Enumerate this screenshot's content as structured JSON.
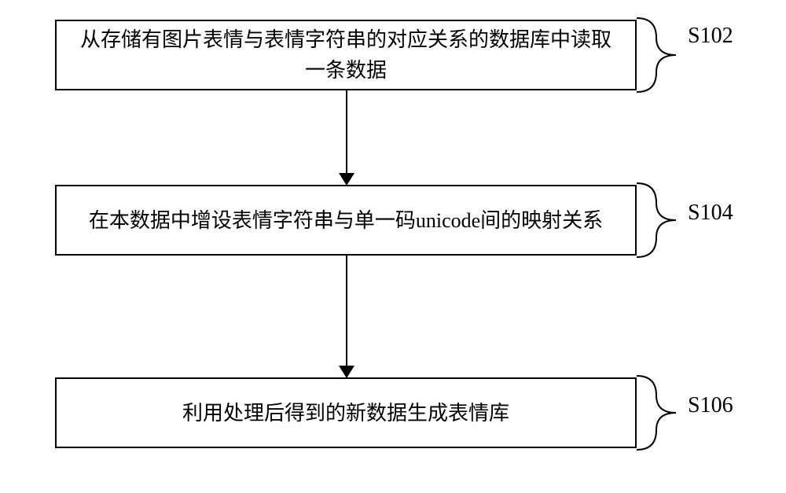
{
  "chart_data": {
    "type": "flowchart",
    "steps": [
      {
        "id": "S102",
        "text": "从存储有图片表情与表情字符串的对应关系的数据库中读取一条数据"
      },
      {
        "id": "S104",
        "text": "在本数据中增设表情字符串与单一码unicode间的映射关系"
      },
      {
        "id": "S106",
        "text": "利用处理后得到的新数据生成表情库"
      }
    ],
    "flow": [
      "S102",
      "S104",
      "S106"
    ]
  },
  "step1": {
    "text": "从存储有图片表情与表情字符串的对应关系的数据库中读取一条数据",
    "label": "S102"
  },
  "step2": {
    "text": "在本数据中增设表情字符串与单一码unicode间的映射关系",
    "label": "S104"
  },
  "step3": {
    "text": "利用处理后得到的新数据生成表情库",
    "label": "S106"
  }
}
